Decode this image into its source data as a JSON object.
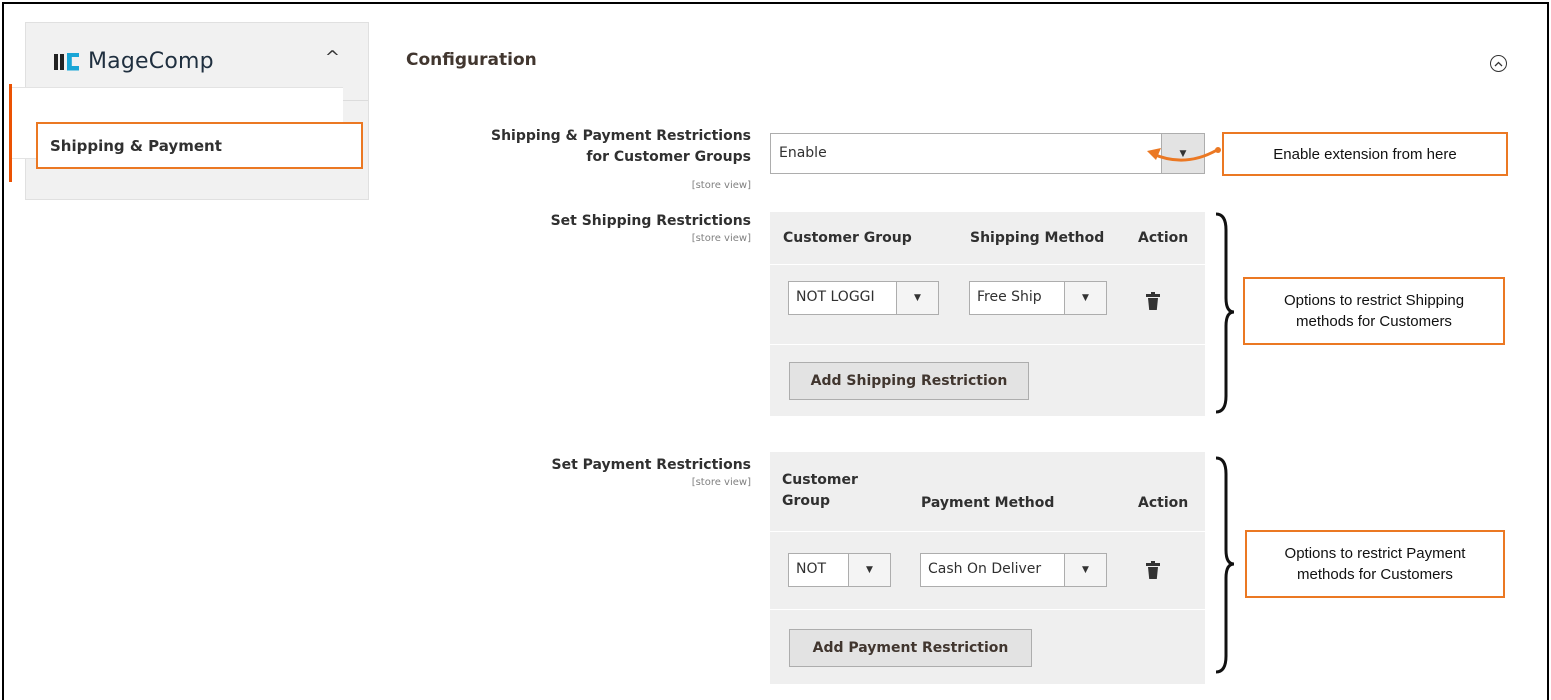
{
  "sidebar": {
    "brand": "MageComp",
    "caret": "^",
    "active_item": "Shipping & Payment"
  },
  "main": {
    "title": "Configuration",
    "collapse_glyph": "⌃"
  },
  "fields": {
    "restrictions": {
      "label_line1": "Shipping & Payment Restrictions",
      "label_line2": "for Customer Groups",
      "scope": "[store view]",
      "value": "Enable"
    },
    "shipping": {
      "label": "Set Shipping Restrictions",
      "scope": "[store view]",
      "col_customer_group": "Customer Group",
      "col_method": "Shipping Method",
      "col_action": "Action",
      "row_group": "NOT LOGGI",
      "row_method": "Free Ship",
      "add_label": "Add Shipping Restriction"
    },
    "payment": {
      "label": "Set Payment Restrictions",
      "scope": "[store view]",
      "col_customer_group_1": "Customer",
      "col_customer_group_2": "Group",
      "col_method": "Payment Method",
      "col_action": "Action",
      "row_group": "NOT",
      "row_method": "Cash On Deliver",
      "add_label": "Add Payment Restriction"
    }
  },
  "callouts": {
    "enable": "Enable extension from here",
    "shipping_1": "Options to restrict Shipping",
    "shipping_2": "methods for Customers",
    "payment_1": "Options to restrict Payment",
    "payment_2": "methods for Customers"
  },
  "icons": {
    "dropdown": "▼",
    "trash": "trash-icon",
    "accent": "#eb7823"
  }
}
